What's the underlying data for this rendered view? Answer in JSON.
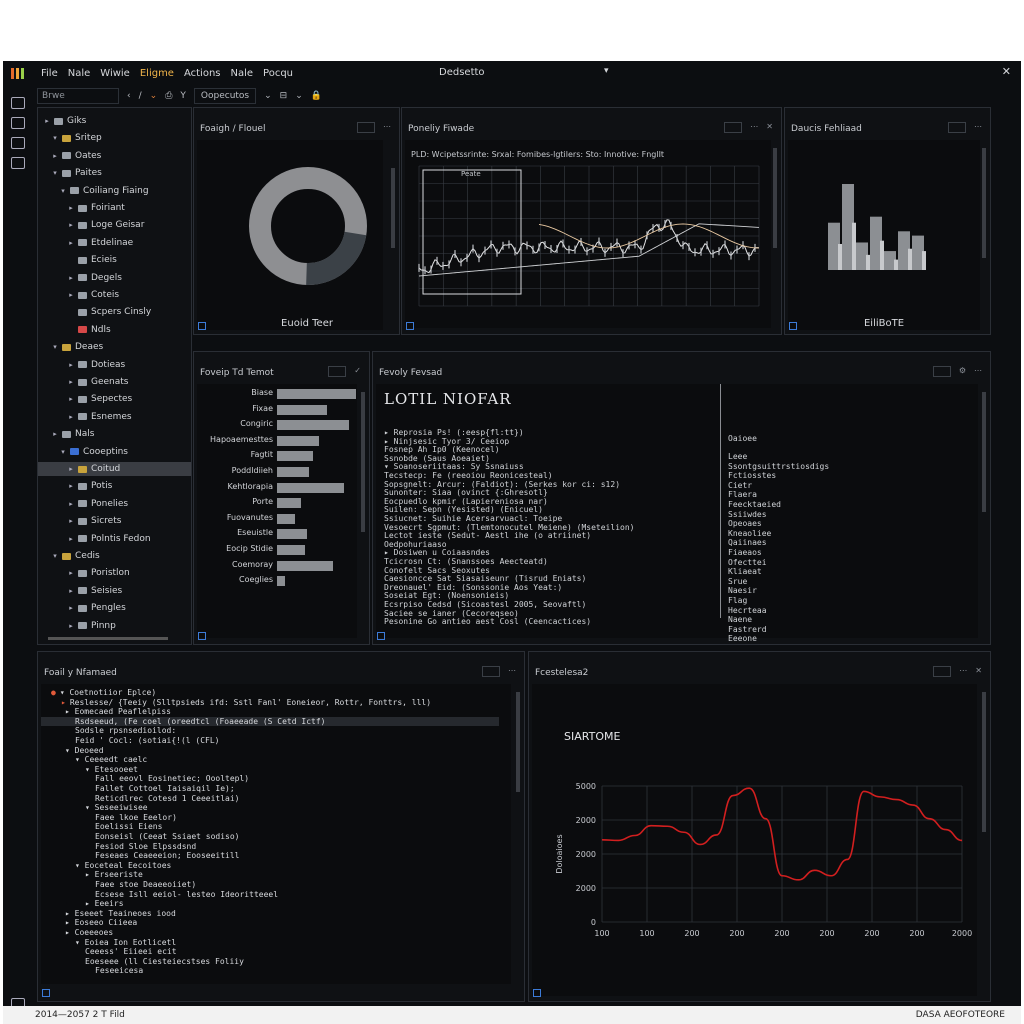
{
  "menubar": {
    "items": [
      "File",
      "Nale",
      "Wiwie",
      "Eligme",
      "Actions",
      "Nale",
      "Pocqu"
    ],
    "active_index": 3,
    "window_title": "Dedsetto",
    "dropdown_glyph": "▾",
    "close_glyph": "✕"
  },
  "toolbar": {
    "search_placeholder": "Brwe",
    "buttons": [
      "‹",
      "/",
      "⌄",
      "⎙",
      "Y"
    ],
    "dropdown_label": "Oopecutos",
    "trailing": [
      "⌄",
      "⊟",
      "⌄",
      "🔒"
    ]
  },
  "sidebar": {
    "items": [
      {
        "label": "Giks",
        "indent": 0,
        "arrow": "▸",
        "icon": "grey"
      },
      {
        "label": "Sritep",
        "indent": 1,
        "arrow": "▾",
        "icon": "yellow"
      },
      {
        "label": "Oates",
        "indent": 1,
        "arrow": "▸",
        "icon": "grey"
      },
      {
        "label": "Paites",
        "indent": 1,
        "arrow": "▾",
        "icon": "grey"
      },
      {
        "label": "Coiliang Fiaing",
        "indent": 2,
        "arrow": "▾",
        "icon": "grey"
      },
      {
        "label": "Foiriant",
        "indent": 3,
        "arrow": "▸",
        "icon": "grey"
      },
      {
        "label": "Loge Geisar",
        "indent": 3,
        "arrow": "▸",
        "icon": "grey"
      },
      {
        "label": "Etdelinae",
        "indent": 3,
        "arrow": "▸",
        "icon": "grey"
      },
      {
        "label": "Ecieis",
        "indent": 3,
        "arrow": "",
        "icon": "grey"
      },
      {
        "label": "Degels",
        "indent": 3,
        "arrow": "▸",
        "icon": "grey"
      },
      {
        "label": "Coteis",
        "indent": 3,
        "arrow": "▸",
        "icon": "grey"
      },
      {
        "label": "Scpers Cinsly",
        "indent": 3,
        "arrow": "",
        "icon": "grey"
      },
      {
        "label": "Ndls",
        "indent": 3,
        "arrow": "",
        "icon": "red"
      },
      {
        "label": "Deaes",
        "indent": 1,
        "arrow": "▾",
        "icon": "yellow"
      },
      {
        "label": "Dotieas",
        "indent": 3,
        "arrow": "▸",
        "icon": "grey"
      },
      {
        "label": "Geenats",
        "indent": 3,
        "arrow": "▸",
        "icon": "grey"
      },
      {
        "label": "Sepectes",
        "indent": 3,
        "arrow": "▸",
        "icon": "grey"
      },
      {
        "label": "Esnemes",
        "indent": 3,
        "arrow": "▸",
        "icon": "grey"
      },
      {
        "label": "Nals",
        "indent": 1,
        "arrow": "▸",
        "icon": "grey"
      },
      {
        "label": "Cooeptins",
        "indent": 2,
        "arrow": "▾",
        "icon": "blue"
      },
      {
        "label": "Coitud",
        "indent": 3,
        "arrow": "▸",
        "icon": "yellow",
        "selected": true
      },
      {
        "label": "Potis",
        "indent": 3,
        "arrow": "▸",
        "icon": "grey"
      },
      {
        "label": "Ponelies",
        "indent": 3,
        "arrow": "▸",
        "icon": "grey"
      },
      {
        "label": "Sicrets",
        "indent": 3,
        "arrow": "▸",
        "icon": "grey"
      },
      {
        "label": "Polntis Fedon",
        "indent": 3,
        "arrow": "▸",
        "icon": "grey"
      },
      {
        "label": "Cedis",
        "indent": 1,
        "arrow": "▾",
        "icon": "yellow"
      },
      {
        "label": "Poristlon",
        "indent": 3,
        "arrow": "▸",
        "icon": "grey"
      },
      {
        "label": "Seisies",
        "indent": 3,
        "arrow": "▸",
        "icon": "grey"
      },
      {
        "label": "Pengles",
        "indent": 3,
        "arrow": "▸",
        "icon": "grey"
      },
      {
        "label": "Pinnp",
        "indent": 3,
        "arrow": "▸",
        "icon": "grey"
      }
    ]
  },
  "panels": {
    "donut": {
      "title": "Foaigh / Flouel",
      "footer": "Euoid Teer",
      "ring_color": "#8e8f92",
      "slice_color": "#3b4147",
      "slice_fraction": 0.23
    },
    "finance": {
      "title": "Poneliy Fiwade",
      "banner": "PLD: Wcipetssrinte: Srxal: Fomibes-lgtilers: Sto: Innotive: FnglIt",
      "inner_label": "Peate"
    },
    "bars": {
      "title": "Daucis Fehliaad",
      "footer": "EiliBoTE",
      "values": [
        0.55,
        1.0,
        0.32,
        0.62,
        0.22,
        0.45,
        0.4
      ],
      "color": "#8c8f93"
    },
    "horizontal": {
      "title": "Foveip Td Temot",
      "labels": [
        "Biase",
        "Fixae",
        "Congiric",
        "Hapoaemesttes",
        "Fagtit",
        "Poddldiieh",
        "Kehtlorapia",
        "Porte",
        "Fuovanutes",
        "Eseuistle",
        "Eocip Stidie",
        "Coemoray",
        "Coeglies"
      ],
      "values": [
        0.99,
        0.62,
        0.9,
        0.52,
        0.45,
        0.4,
        0.84,
        0.3,
        0.23,
        0.37,
        0.35,
        0.7,
        0.1
      ]
    },
    "properties": {
      "title": "Fevoly Fevsad",
      "heading": "LOTIL NIOFAR",
      "lines": [
        "▸ Reprosia Ps! (:eesp{fl:tt})",
        "  ▸ Ninjsesic Tyor 3/ Ceeiop",
        "    Fosnep Ah Ip0 (Keenocel)",
        "    Ssnobde (Saus Aoeaiet)",
        "   ▾ Soanoseriitaas: Sy Ssnaiuss",
        "      Tecstecp: Fe (reeoiou Reonicesteal)",
        "      Sopsgnelt: Arcur: (Faldiot): (Serkes kor ci: s12)",
        "      Sunonter: Siaa (ovinct {:Ghresotl}",
        "      Eocpuedlo kpmir (Lapiereniosa nar)",
        "      Suilen: Sepn (Yesisted) (Enicuel)",
        "      Ssiucnet: Suihie Acersarvuacl: Toeipe",
        "      Vesoecrt Sgpmut: (Tlemtonocutel Meiene) (Mseteilion)",
        "      Lectot ieste (Sedut- Aestl ihe (o atriinet)",
        "      Oedpohuriaaso",
        "  ▸ Dosiwen u Coiaasndes",
        "    Tcicrosn Ct: (Snanssoes Aeecteatd)",
        "    Conofelt Sacs Seoxutes",
        "    Caesioncce Sat Siasaiseunr (Tisrud Eniats)",
        "    Dreonauel' Eid: (Sonssonie Aos Yeat:)",
        "    Soseiat Egt: (Noensonieis)",
        "    Ecsrpiso Cedsd (Sicoastesl 2005, Seovaftl)",
        "    Saciee se ianer (Cecoreqseo)",
        "    Pesonine Go antieo aest Cosl (Ceencactices)"
      ],
      "side_header": "Oaioee",
      "side_items": [
        "Leee",
        "Ssontgsuittrstiosdigs",
        "Fctiosstes",
        "Cietr",
        "Flaera",
        "Feecktaeied",
        "Ssiiwdes",
        "Opeoaes",
        "Kneaoliee",
        "Qaiinaes",
        "Fiaeaos",
        "Ofecttei",
        "Kliaeat",
        "Srue",
        "Naesir",
        "Flag",
        "Hecrteaa",
        "Naene",
        "Fastrerd",
        "Eeeone"
      ]
    },
    "code": {
      "title": "Foail y Nfamaed",
      "lines": [
        {
          "indent": 0,
          "text": "▾ Coetnotiior Eplce)",
          "mark": "●"
        },
        {
          "indent": 1,
          "text": "Reslesse/ {Teeiy (Slltpsieds ifd: Sstl Fanl' Eoneieor, Rottr, Fonttrs, lll)",
          "mark": "▸"
        },
        {
          "indent": 1,
          "text": "▸ Eomecaed Peaflelpiss",
          "mark": ""
        },
        {
          "indent": 2,
          "text": "Rsdseeud, (Fe coel (oreedtcl (Foaeeade (S Cetd Ictf)",
          "mark": "",
          "hl": true
        },
        {
          "indent": 2,
          "text": "Sodsle rpsnsedioilod:",
          "mark": ""
        },
        {
          "indent": 2,
          "text": "Feid ' Cocl: (sotiai{!(l (CFL)",
          "mark": ""
        },
        {
          "indent": 1,
          "text": "▾ Deoeed",
          "mark": ""
        },
        {
          "indent": 2,
          "text": "▾ Ceeeedt caelc",
          "mark": ""
        },
        {
          "indent": 3,
          "text": "▾ Etesooeet",
          "mark": ""
        },
        {
          "indent": 4,
          "text": "Fall eeovl Eosinetiec; Oooltepl)",
          "mark": ""
        },
        {
          "indent": 4,
          "text": "Fallet Cottoel Iaisaiqil Ie);",
          "mark": ""
        },
        {
          "indent": 4,
          "text": "Reticdlrec Cotesd 1 Ceeeitlai)",
          "mark": ""
        },
        {
          "indent": 3,
          "text": "▾ Seseeiwisee",
          "mark": ""
        },
        {
          "indent": 4,
          "text": "Faee lkoe Eeelor)",
          "mark": ""
        },
        {
          "indent": 4,
          "text": "Eoelissi Eiens",
          "mark": ""
        },
        {
          "indent": 4,
          "text": "Eonseisl (Ceeat Ssiaet sodiso)",
          "mark": ""
        },
        {
          "indent": 4,
          "text": "Fesiod Sloe Elpssdsnd",
          "mark": ""
        },
        {
          "indent": 4,
          "text": "Feseaes Ceaeeeion; Eooseeitill",
          "mark": ""
        },
        {
          "indent": 2,
          "text": "▾ Eoceteal Eecoitoes",
          "mark": ""
        },
        {
          "indent": 3,
          "text": "▸ Erseeriste",
          "mark": ""
        },
        {
          "indent": 4,
          "text": "Faee stoe Deaeeoiiet)",
          "mark": ""
        },
        {
          "indent": 4,
          "text": "Ecsese Isll eeiol- lesteo Ideoritteeel",
          "mark": ""
        },
        {
          "indent": 3,
          "text": "▸ Eeeirs",
          "mark": ""
        },
        {
          "indent": 1,
          "text": "▸ Eseeet Teaineoes iood",
          "mark": ""
        },
        {
          "indent": 1,
          "text": "▸ Eoseeo Ciieea",
          "mark": ""
        },
        {
          "indent": 1,
          "text": "▸ Coeeeoes",
          "mark": ""
        },
        {
          "indent": 2,
          "text": "▾ Eoiea Ion Eotlicetl",
          "mark": ""
        },
        {
          "indent": 3,
          "text": "Ceeess' Eiieei ecit",
          "mark": ""
        },
        {
          "indent": 3,
          "text": "Eoeseee (ll Ciesteiecstses Foliiy",
          "mark": ""
        },
        {
          "indent": 4,
          "text": "Feseeicesa",
          "mark": ""
        }
      ]
    },
    "timeseries": {
      "title": "Fcestelesa2",
      "chart_title": "SIARTOME"
    }
  },
  "chart_data": {
    "type": "line",
    "title": "SIARTOME",
    "xlabel": "",
    "ylabel": "Doloaioes",
    "x": [
      100,
      200,
      300,
      400,
      500,
      600,
      700,
      800,
      900,
      1000,
      1100,
      1200,
      1300,
      1400,
      1500,
      1600,
      1700,
      1800,
      1900,
      2000,
      2100,
      2200,
      2300
    ],
    "xticks": [
      "100",
      "100",
      "200",
      "200",
      "200",
      "200",
      "200",
      "200",
      "2000"
    ],
    "yticks": [
      "0",
      "2000",
      "2000",
      "2000",
      "5000"
    ],
    "ylim": [
      0,
      5000
    ],
    "series": [
      {
        "values": [
          3020,
          3000,
          3180,
          3540,
          3520,
          3300,
          2850,
          3200,
          4650,
          4920,
          3800,
          1700,
          1550,
          1900,
          1700,
          2300,
          4800,
          4600,
          4500,
          4300,
          3800,
          3400,
          3000
        ],
        "color": "#d21f1f"
      }
    ],
    "grid": true
  },
  "statusbar": {
    "left": "2014—2057 2 T  Fild",
    "right": "DASA AEOFOTEORE"
  }
}
